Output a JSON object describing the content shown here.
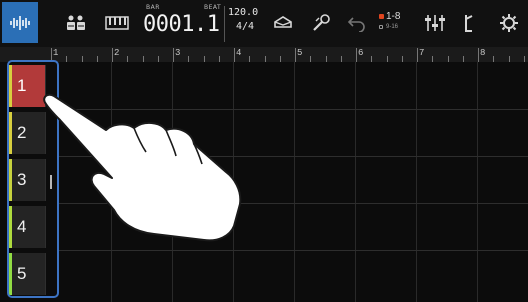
{
  "toolbar": {
    "buttons": [
      {
        "name": "waveform-icon",
        "active": true
      },
      {
        "name": "drums-icon",
        "active": false
      },
      {
        "name": "keyboard-icon",
        "active": false
      }
    ],
    "counter": {
      "bar_label": "BAR",
      "beat_label": "BEAT",
      "value": "0001.1"
    },
    "tempo": {
      "bpm": "120.0",
      "time_signature": "4/4"
    },
    "tools": [
      "eraser-icon",
      "record-tool-icon",
      "undo-icon"
    ],
    "range": {
      "main": "1-8",
      "sub": "9-16"
    },
    "right_tools": [
      "mixer-icon",
      "metronome-icon",
      "settings-icon"
    ]
  },
  "ruler": {
    "marks": [
      "1",
      "2",
      "3",
      "4",
      "5",
      "6",
      "7",
      "8"
    ]
  },
  "tracks": [
    {
      "number": "1",
      "selected": true,
      "color": "#d7cf3f"
    },
    {
      "number": "2",
      "selected": false,
      "color": "#d7cf3f"
    },
    {
      "number": "3",
      "selected": false,
      "color": "#c6d23e"
    },
    {
      "number": "4",
      "selected": false,
      "color": "#aedb3e"
    },
    {
      "number": "5",
      "selected": false,
      "color": "#91dc44"
    }
  ],
  "colors": {
    "accent": "#2b6fb6",
    "selected_track": "#b23a3a",
    "highlight": "#3d74c4"
  }
}
